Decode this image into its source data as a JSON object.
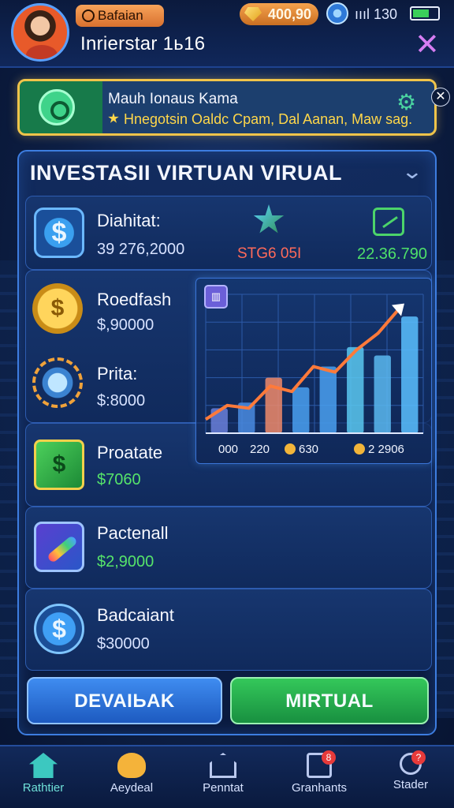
{
  "header": {
    "tag_label": "Bafaian",
    "player_name": "Inrierstar 1ь16",
    "coins": "400,90",
    "signal": "ıııl",
    "time": "130",
    "close_symbol": "✕"
  },
  "banner": {
    "title": "Mauh Ionaus Kamа",
    "text": "Hnegotsin Oaldc Cpam, Dal Aanan, Maw sag.",
    "close_symbol": "✕",
    "gear_symbol": "⚙"
  },
  "panel": {
    "title": "INVESTASII VIRTUAN VIRUAL",
    "chevron": "⌄",
    "summary": {
      "label": "Diahitat:",
      "amount": "39 276,2000",
      "code": "STG6 05I",
      "value": "22.36.790"
    },
    "rows": [
      {
        "label": "Roedfash",
        "amount": "$,90000",
        "icon": "gold-coins-icon",
        "color": "white"
      },
      {
        "label": "Prita:",
        "amount": "$:8000",
        "icon": "magnifier-icon",
        "color": "white"
      },
      {
        "label": "Proatate",
        "amount": "$7060",
        "icon": "cash-icon",
        "color": "green"
      },
      {
        "label": "Pactenall",
        "amount": "$2,9000",
        "icon": "rocket-icon",
        "color": "green"
      },
      {
        "label": "Badcaiant",
        "amount": "$30000",
        "icon": "dollar-badge-icon",
        "color": "white"
      }
    ]
  },
  "chart_data": {
    "type": "bar",
    "title": "",
    "xlabel": "",
    "ylabel": "",
    "tick_labels": [
      "000",
      "220",
      "630",
      "2 2906"
    ],
    "bar_colors": [
      "#6a7fd8",
      "#4a8be0",
      "#f08a6a",
      "#4aa0f0",
      "#4aa0f0",
      "#5ac8f0",
      "#5ab8f0",
      "#5ac0ff"
    ],
    "values": [
      18,
      22,
      40,
      33,
      48,
      62,
      56,
      84
    ],
    "trend": [
      10,
      20,
      18,
      34,
      30,
      48,
      44,
      60,
      72,
      90
    ],
    "ylim": [
      0,
      100
    ],
    "legend": "none",
    "grid": true
  },
  "actions": {
    "left_label": "DEVAIЬAK",
    "right_label": "MIRTUAL"
  },
  "nav": [
    {
      "label": "Rathtier",
      "icon": "home-icon",
      "active": true
    },
    {
      "label": "Aeydeal",
      "icon": "heart-icon",
      "active": false
    },
    {
      "label": "Penntat",
      "icon": "house-icon",
      "active": false
    },
    {
      "label": "Granhants",
      "icon": "chart-icon",
      "active": false,
      "badge": "8"
    },
    {
      "label": "Stader",
      "icon": "search-icon",
      "active": false,
      "badge": "?"
    }
  ],
  "colors": {
    "accent_green": "#4ee06a",
    "accent_blue": "#3f8cf0",
    "banner_border": "#f0c44a"
  }
}
